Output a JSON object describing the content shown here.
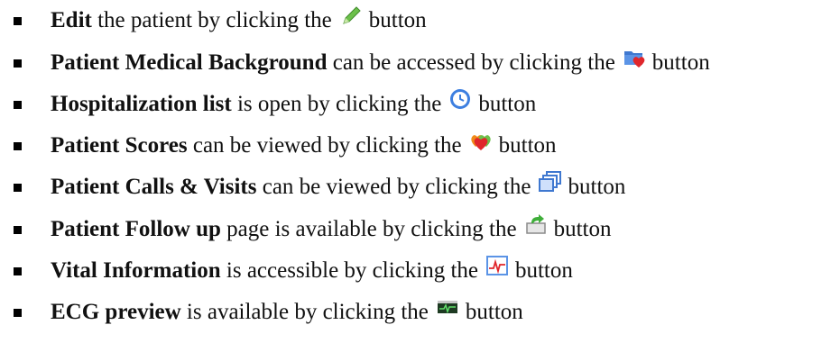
{
  "items": [
    {
      "bold": "Edit",
      "middle": " the patient by clicking the",
      "icon": "pencil-icon",
      "after": "button"
    },
    {
      "bold": "Patient Medical Background",
      "middle": " can be accessed by clicking the",
      "icon": "folder-heart-icon",
      "after": "button"
    },
    {
      "bold": "Hospitalization list",
      "middle": " is open by clicking the",
      "icon": "clock-icon",
      "after": "button"
    },
    {
      "bold": "Patient Scores",
      "middle": " can be viewed by clicking the",
      "icon": "hearts-icon",
      "after": "button"
    },
    {
      "bold": "Patient Calls & Visits",
      "middle": " can be viewed by clicking the",
      "icon": "stacked-windows-icon",
      "after": "button"
    },
    {
      "bold": "Patient Follow up",
      "middle": " page is available by clicking the",
      "icon": "tray-arrow-icon",
      "after": "button"
    },
    {
      "bold": "Vital Information",
      "middle": " is accessible by clicking the",
      "icon": "vital-chart-icon",
      "after": "button"
    },
    {
      "bold": "ECG preview",
      "middle": " is available by clicking the",
      "icon": "ecg-monitor-icon",
      "after": "button"
    }
  ],
  "colors": {
    "text": "#111111",
    "pencil": "#6cc04a",
    "folder": "#3f78d0",
    "heart": "#e0262b",
    "clock": "#3d7fe0",
    "monitor": "#2f8a3b"
  }
}
